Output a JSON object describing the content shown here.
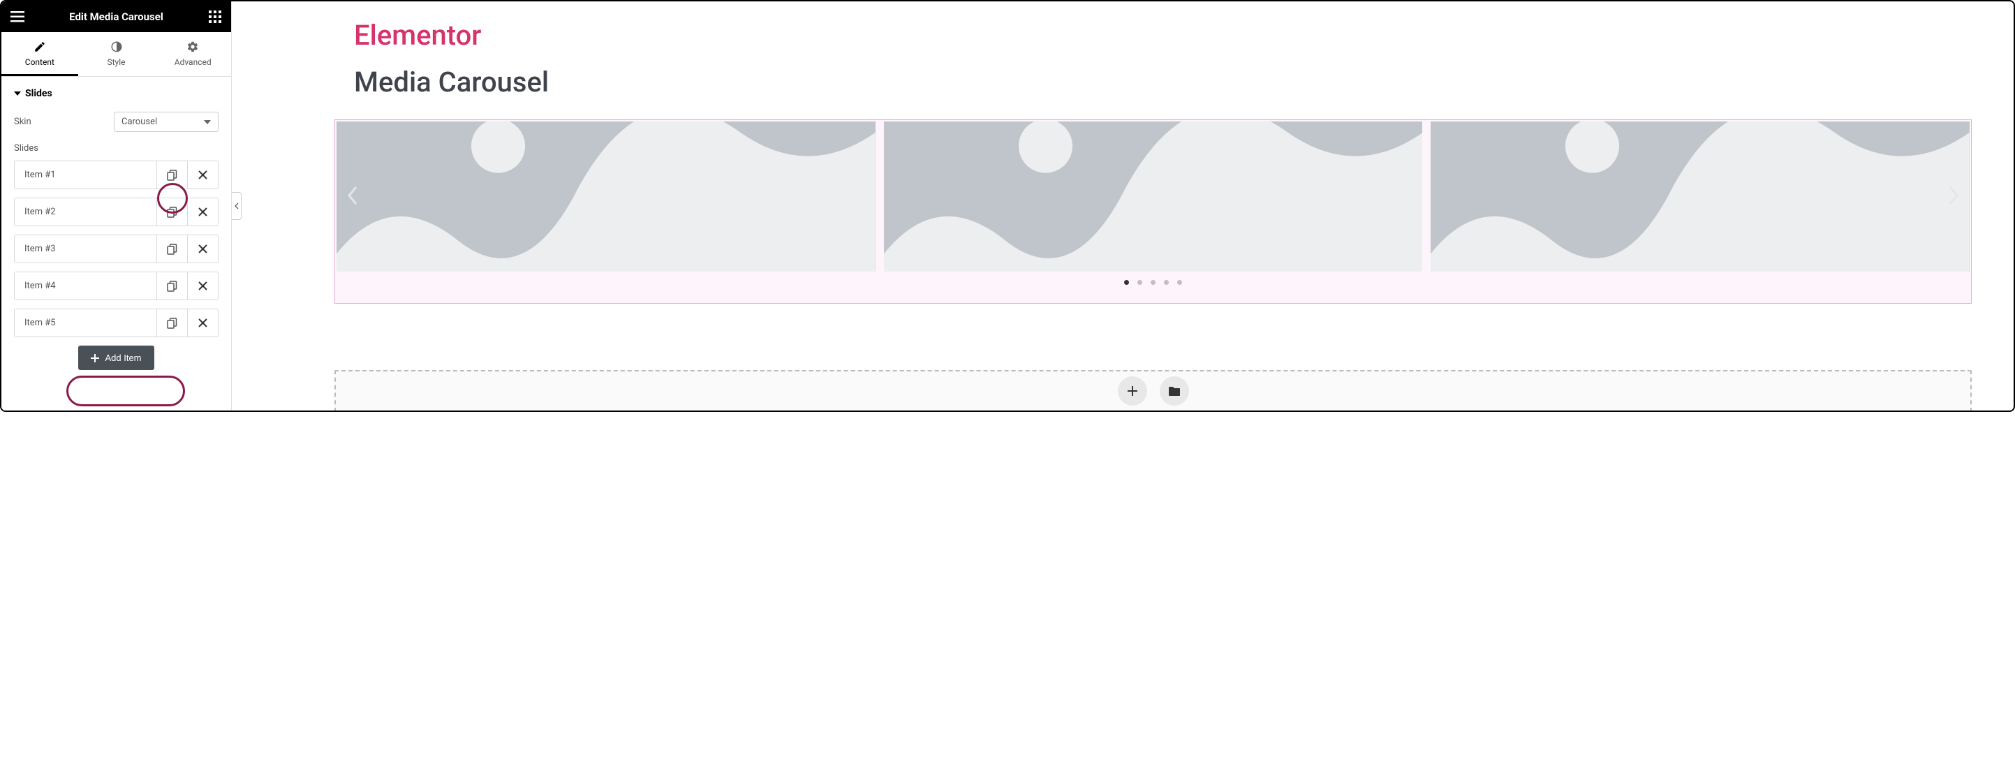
{
  "header": {
    "title": "Edit Media Carousel"
  },
  "tabs": {
    "content": "Content",
    "style": "Style",
    "advanced": "Advanced"
  },
  "section": {
    "slides_title": "Slides"
  },
  "fields": {
    "skin_label": "Skin",
    "skin_value": "Carousel",
    "slides_label": "Slides"
  },
  "slides": [
    {
      "label": "Item #1"
    },
    {
      "label": "Item #2"
    },
    {
      "label": "Item #3"
    },
    {
      "label": "Item #4"
    },
    {
      "label": "Item #5"
    }
  ],
  "buttons": {
    "add_item": "Add Item"
  },
  "preview": {
    "brand": "Elementor",
    "widget_title": "Media Carousel",
    "dot_count": 5,
    "active_dot": 0
  }
}
